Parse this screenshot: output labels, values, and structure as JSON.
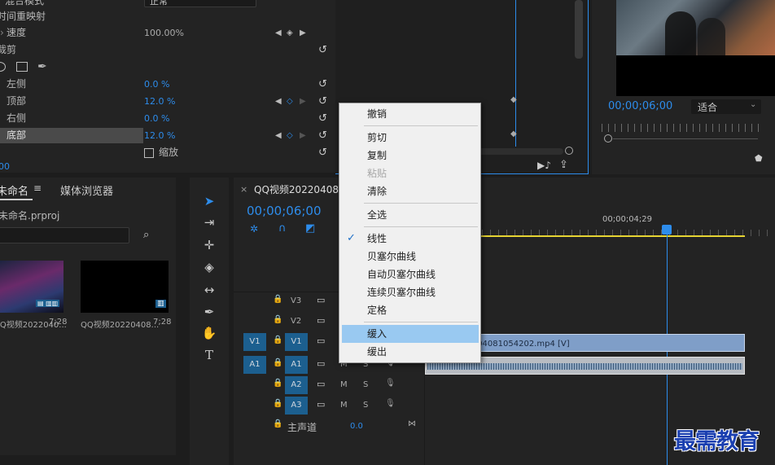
{
  "effect_controls": {
    "blend_mode_label": "混合模式",
    "blend_mode_value": "正常",
    "time_remap_label": "时间重映射",
    "speed_label": "速度",
    "speed_value": "100.00%",
    "crop_label": "裁剪",
    "left_label": "左侧",
    "left_value": "0.0 %",
    "top_label": "顶部",
    "top_value": "12.0 %",
    "right_label": "右侧",
    "right_value": "0.0 %",
    "bottom_label": "底部",
    "bottom_value": "12.0 %",
    "zoom_label": "缩放",
    "timecode": "00"
  },
  "program_monitor": {
    "timecode": "00;00;06;00",
    "fit_label": "适合"
  },
  "project_panel": {
    "tab_project": "未命名",
    "tab_media_browser": "媒体浏览器",
    "project_file": "未命名.prproj",
    "items": [
      {
        "name": "QQ视频2022040...",
        "duration": "7;28"
      },
      {
        "name": "QQ视频20220408...",
        "duration": "7;28"
      }
    ]
  },
  "timeline": {
    "sequence_tab": "QQ视频20220408105",
    "close_glyph": "×",
    "timecode": "00;00;06;00",
    "ruler_label": "00;00;04;29",
    "clip_label": "QQ视频20220408105420​2.mp4 [V]",
    "tracks": {
      "v3": "V3",
      "v2": "V2",
      "v1": "V1",
      "v1_src": "V1",
      "a1": "A1",
      "a1_src": "A1",
      "a2": "A2",
      "a3": "A3",
      "m": "M",
      "s": "S"
    },
    "master_label": "主声道",
    "master_value": "0.0"
  },
  "context_menu": {
    "items": [
      {
        "label": "撤销",
        "state": "normal"
      },
      {
        "label": "剪切",
        "state": "normal"
      },
      {
        "label": "复制",
        "state": "normal"
      },
      {
        "label": "粘贴",
        "state": "disabled"
      },
      {
        "label": "清除",
        "state": "normal"
      },
      {
        "label": "全选",
        "state": "normal"
      },
      {
        "label": "线性",
        "state": "checked"
      },
      {
        "label": "贝塞尔曲线",
        "state": "normal"
      },
      {
        "label": "自动贝塞尔曲线",
        "state": "normal"
      },
      {
        "label": "连续贝塞尔曲线",
        "state": "normal"
      },
      {
        "label": "定格",
        "state": "normal"
      },
      {
        "label": "缓入",
        "state": "highlighted"
      },
      {
        "label": "缓出",
        "state": "normal"
      }
    ],
    "check_glyph": "✓"
  },
  "watermark": "最需教育",
  "colors": {
    "accent_blue": "#2d8ceb",
    "track_blue": "#1c5f8f",
    "menu_highlight": "#99c9f1",
    "workarea_yellow": "#e6d432"
  },
  "icons": {
    "reset": "↺",
    "prev": "◀",
    "next": "▶",
    "add_kf": "◇",
    "kf": "◆",
    "lock": "🔒",
    "film": "▭",
    "mic": "🎙",
    "wrench": "🔧",
    "search": "⌕"
  }
}
